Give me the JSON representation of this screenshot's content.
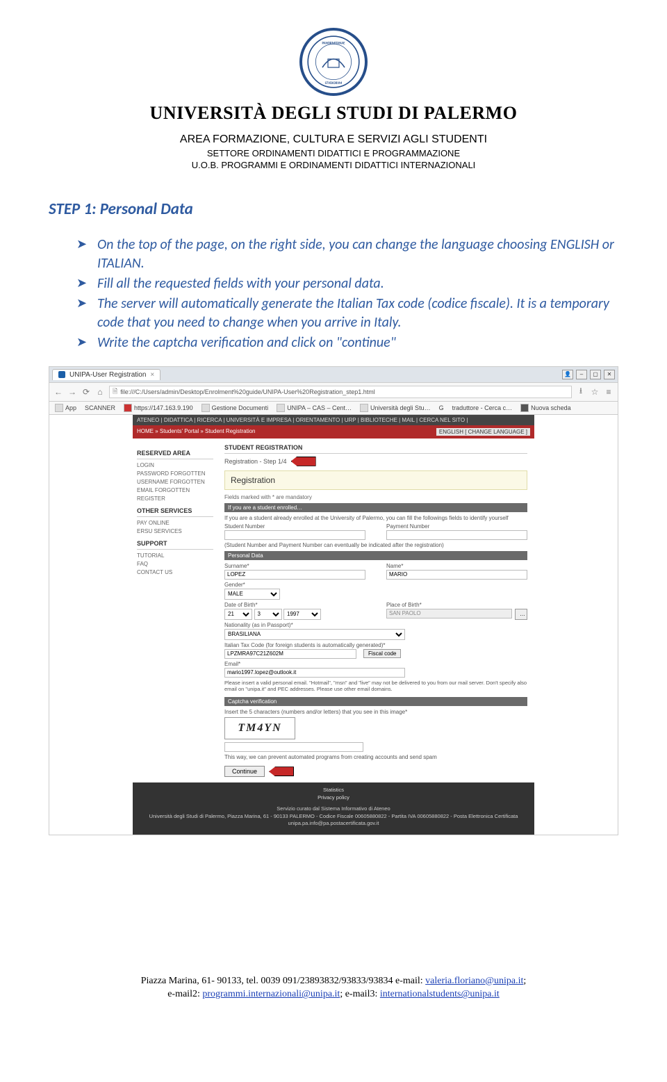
{
  "header": {
    "university": "UNIVERSITÀ DEGLI STUDI DI PALERMO",
    "area": "AREA FORMAZIONE, CULTURA E SERVIZI AGLI STUDENTI",
    "settore": "SETTORE ORDINAMENTI DIDATTICI E PROGRAMMAZIONE",
    "uob": "U.O.B. PROGRAMMI E ORDINAMENTI DIDATTICI INTERNAZIONALI"
  },
  "step_title": "STEP 1: Personal Data",
  "bullets": [
    "On the top of the page, on the right side, you can change the language choosing ENGLISH or ITALIAN.",
    "Fill all the requested fields with your personal data.",
    "The server will automatically generate the Italian Tax code (codice fiscale). It is a temporary code that you need to change when you arrive in Italy.",
    "Write the captcha verification and click on \"continue\""
  ],
  "browser": {
    "tab_title": "UNIPA-User Registration",
    "url": "file:///C:/Users/admin/Desktop/Enrolment%20guide/UNIPA-User%20Registration_step1.html",
    "bookmarks": [
      "App",
      "SCANNER",
      "https://147.163.9.190",
      "Gestione Documenti",
      "UNIPA – CAS – Cent…",
      "Università degli Stu…",
      "G",
      "traduttore - Cerca c…",
      "Nuova scheda"
    ]
  },
  "portal": {
    "topnav": "ATENEO  |  DIDATTICA  |  RICERCA  |  UNIVERSITÀ E IMPRESA  |  ORIENTAMENTO  |  URP  |  BIBLIOTECHE  |  MAIL  |  CERCA NEL SITO  |",
    "breadcrumb": "HOME » Students' Portal » Student Registration",
    "lang_button": "ENGLISH [ CHANGE LANGUAGE ]",
    "left": {
      "reserved": "RESERVED AREA",
      "reserved_links": [
        "LOGIN",
        "PASSWORD FORGOTTEN",
        "USERNAME FORGOTTEN",
        "EMAIL FORGOTTEN",
        "REGISTER"
      ],
      "other": "OTHER SERVICES",
      "other_links": [
        "PAY ONLINE",
        "ERSU SERVICES"
      ],
      "support": "SUPPORT",
      "support_links": [
        "TUTORIAL",
        "FAQ",
        "CONTACT US"
      ]
    },
    "main": {
      "title": "STUDENT REGISTRATION",
      "step": "Registration - Step 1/4",
      "reg_heading": "Registration",
      "mandatory": "Fields marked with * are mandatory",
      "band_enrolled": "If you are a student enrolled…",
      "enrolled_help": "If you are a student already enrolled at the University of Palermo, you can fill the followings fields to identify yourself",
      "student_number_label": "Student Number",
      "payment_number_label": "Payment Number",
      "after_reg_note": "(Student Number and Payment Number can eventually be indicated after the registration)",
      "band_personal": "Personal Data",
      "surname_label": "Surname*",
      "surname_value": "LOPEZ",
      "name_label": "Name*",
      "name_value": "MARIO",
      "gender_label": "Gender*",
      "gender_value": "MALE",
      "dob_label": "Date of Birth*",
      "dob_day": "21",
      "dob_month": "3",
      "dob_year": "1997",
      "pob_label": "Place of Birth*",
      "pob_value": "SAN PAOLO",
      "nat_label": "Nationality (as in Passport)*",
      "nat_value": "BRASILIANA",
      "tax_label": "Italian Tax Code (for foreign students is automatically generated)*",
      "tax_value": "LPZMRA97C21Z602M",
      "fiscal_btn": "Fiscal code",
      "email_label": "Email*",
      "email_value": "mario1997.lopez@outlook.it",
      "email_warn": "Please insert a valid personal email. \"Hotmail\", \"msn\" and \"live\" may not be delivered to you from our mail server. Don't specify also email on \"unipa.it\" and PEC addresses. Please use other email domains.",
      "band_captcha": "Captcha verification",
      "captcha_prompt": "Insert the 5 characters (numbers and/or letters) that you see in this image*",
      "captcha_text": "TM4YN",
      "captcha_note": "This way, we can prevent automated programs from creating accounts and send spam",
      "continue_btn": "Continue"
    },
    "footer": {
      "line1": "Statistics",
      "line2": "Privacy policy",
      "line3": "Servizio curato dal Sistema Informativo di Ateneo",
      "line4": "Università degli Studi di Palermo, Piazza Marina, 61 - 90133 PALERMO - Codice Fiscale 00605880822 - Partita IVA 00605880822 - Posta Elettronica Certificata unipa.pa.info@pa.postacertificata.gov.it"
    }
  },
  "page_footer": {
    "line1_a": "Piazza Marina, 61- 90133,  tel. 0039 091/23893832/93833/93834 e-mail: ",
    "email1": "valeria.floriano@unipa.it",
    "line2_a": "e-mail2: ",
    "email2": "programmi.internazionali@unipa.it",
    "line2_b": "; e-mail3: ",
    "email3": "internationalstudents@unipa.it"
  }
}
